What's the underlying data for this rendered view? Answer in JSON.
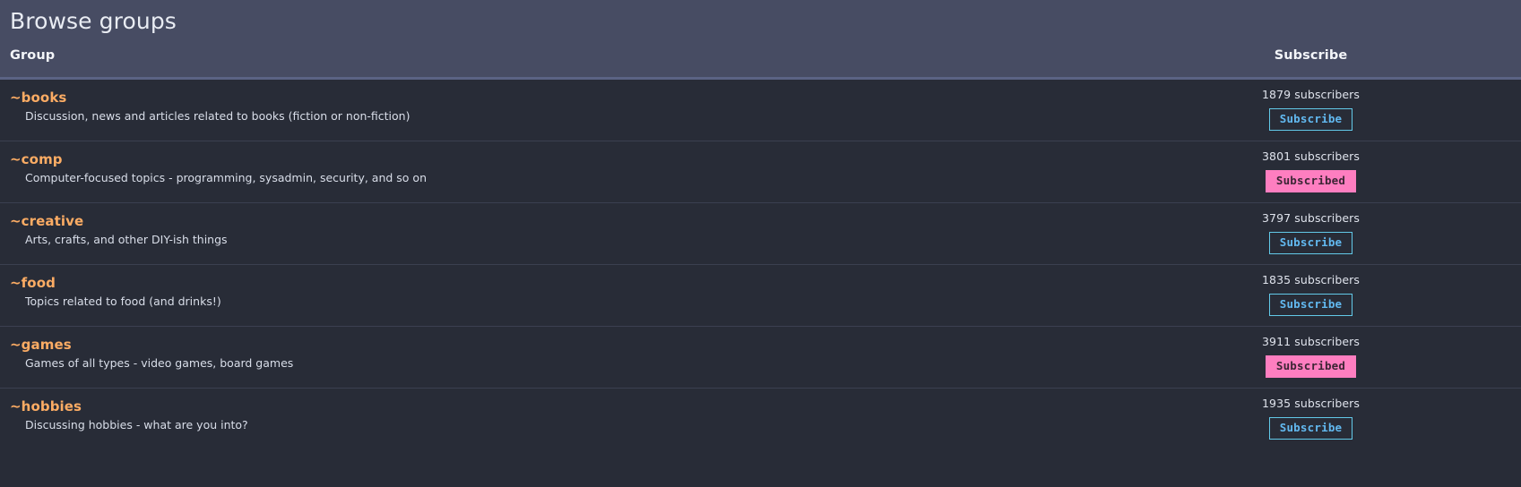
{
  "header": {
    "title": "Browse groups",
    "columns": {
      "group": "Group",
      "subscribe": "Subscribe"
    }
  },
  "colors": {
    "header_bg": "#474c63",
    "header_border": "#5b6384",
    "row_bg": "#282c37",
    "row_divider": "#3b4050",
    "group_name": "#fcac64",
    "description": "#d9dee9",
    "subscribe_border": "#62c9e8",
    "subscribe_text": "#62b9f0",
    "subscribed_bg": "#fe7ec0",
    "subscribed_text": "#3c2534"
  },
  "labels": {
    "subscribe": "Subscribe",
    "subscribed": "Subscribed",
    "subscribers_suffix": "subscribers"
  },
  "groups": [
    {
      "name": "~books",
      "description": "Discussion, news and articles related to books (fiction or non-fiction)",
      "subscriber_count": 1879,
      "subscribers_text": "1879 subscribers",
      "subscribed": false,
      "button_label": "Subscribe"
    },
    {
      "name": "~comp",
      "description": "Computer-focused topics - programming, sysadmin, security, and so on",
      "subscriber_count": 3801,
      "subscribers_text": "3801 subscribers",
      "subscribed": true,
      "button_label": "Subscribed"
    },
    {
      "name": "~creative",
      "description": "Arts, crafts, and other DIY-ish things",
      "subscriber_count": 3797,
      "subscribers_text": "3797 subscribers",
      "subscribed": false,
      "button_label": "Subscribe"
    },
    {
      "name": "~food",
      "description": "Topics related to food (and drinks!)",
      "subscriber_count": 1835,
      "subscribers_text": "1835 subscribers",
      "subscribed": false,
      "button_label": "Subscribe"
    },
    {
      "name": "~games",
      "description": "Games of all types - video games, board games",
      "subscriber_count": 3911,
      "subscribers_text": "3911 subscribers",
      "subscribed": true,
      "button_label": "Subscribed"
    },
    {
      "name": "~hobbies",
      "description": "Discussing hobbies - what are you into?",
      "subscriber_count": 1935,
      "subscribers_text": "1935 subscribers",
      "subscribed": false,
      "button_label": "Subscribe"
    }
  ]
}
